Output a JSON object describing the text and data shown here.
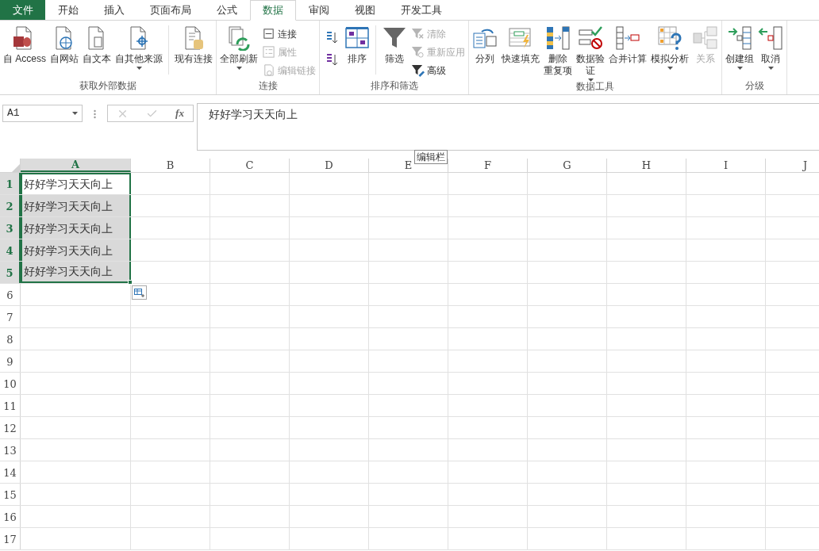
{
  "tabs": [
    {
      "label": "文件",
      "kind": "file",
      "selected": false
    },
    {
      "label": "开始",
      "kind": "tab",
      "selected": false
    },
    {
      "label": "插入",
      "kind": "tab",
      "selected": false
    },
    {
      "label": "页面布局",
      "kind": "tab",
      "selected": false
    },
    {
      "label": "公式",
      "kind": "tab",
      "selected": false
    },
    {
      "label": "数据",
      "kind": "tab",
      "selected": true
    },
    {
      "label": "审阅",
      "kind": "tab",
      "selected": false
    },
    {
      "label": "视图",
      "kind": "tab",
      "selected": false
    },
    {
      "label": "开发工具",
      "kind": "tab",
      "selected": false
    }
  ],
  "ribbon_groups": [
    {
      "label": "获取外部数据",
      "items": [
        {
          "kind": "large",
          "lines": [
            "自 Access"
          ],
          "disabled": false,
          "dropdown": false
        },
        {
          "kind": "large",
          "lines": [
            "自网站"
          ],
          "disabled": false,
          "dropdown": false
        },
        {
          "kind": "large",
          "lines": [
            "自文本"
          ],
          "disabled": false,
          "dropdown": false
        },
        {
          "kind": "large",
          "lines": [
            "自其他来源"
          ],
          "disabled": false,
          "dropdown": true
        },
        {
          "kind": "separator"
        },
        {
          "kind": "large",
          "lines": [
            "现有连接"
          ],
          "disabled": false,
          "dropdown": false
        }
      ]
    },
    {
      "label": "连接",
      "items": [
        {
          "kind": "large",
          "lines": [
            "全部刷新"
          ],
          "disabled": false,
          "dropdown": true
        },
        {
          "kind": "stack",
          "buttons": [
            {
              "label": "连接",
              "disabled": false
            },
            {
              "label": "属性",
              "disabled": true
            },
            {
              "label": "编辑链接",
              "disabled": true
            }
          ]
        }
      ]
    },
    {
      "label": "排序和筛选",
      "items": [
        {
          "kind": "icons"
        },
        {
          "kind": "large",
          "lines": [
            "排序"
          ],
          "disabled": false,
          "dropdown": false
        },
        {
          "kind": "separator"
        },
        {
          "kind": "large",
          "lines": [
            "筛选"
          ],
          "disabled": false,
          "dropdown": false
        },
        {
          "kind": "stack",
          "buttons": [
            {
              "label": "清除",
              "disabled": true
            },
            {
              "label": "重新应用",
              "disabled": true
            },
            {
              "label": "高级",
              "disabled": false
            }
          ]
        }
      ]
    },
    {
      "label": "数据工具",
      "items": [
        {
          "kind": "large",
          "lines": [
            "分列"
          ],
          "disabled": false,
          "dropdown": false
        },
        {
          "kind": "large",
          "lines": [
            "快速填充"
          ],
          "disabled": false,
          "dropdown": false
        },
        {
          "kind": "large",
          "lines": [
            "删除",
            "重复项"
          ],
          "disabled": false,
          "dropdown": false
        },
        {
          "kind": "large",
          "lines": [
            "数据验",
            "证"
          ],
          "disabled": false,
          "dropdown": true
        },
        {
          "kind": "large",
          "lines": [
            "合并计算"
          ],
          "disabled": false,
          "dropdown": false
        },
        {
          "kind": "large",
          "lines": [
            "模拟分析"
          ],
          "disabled": false,
          "dropdown": true
        },
        {
          "kind": "large",
          "lines": [
            "关系"
          ],
          "disabled": true,
          "dropdown": false
        }
      ]
    },
    {
      "label": "分级",
      "items": [
        {
          "kind": "large",
          "lines": [
            "创建组"
          ],
          "disabled": false,
          "dropdown": true
        },
        {
          "kind": "large",
          "lines": [
            "取消"
          ],
          "disabled": false,
          "dropdown": true
        }
      ]
    }
  ],
  "name_box": {
    "value": "A1"
  },
  "formula_bar": {
    "fx": "fx",
    "value": "好好学习天天向上"
  },
  "tooltip": "编辑栏",
  "sheet": {
    "columns": [
      {
        "label": "A",
        "selected": true
      },
      {
        "label": "B",
        "selected": false
      },
      {
        "label": "C",
        "selected": false
      },
      {
        "label": "D",
        "selected": false
      },
      {
        "label": "E",
        "selected": false
      },
      {
        "label": "F",
        "selected": false
      },
      {
        "label": "G",
        "selected": false
      },
      {
        "label": "H",
        "selected": false
      },
      {
        "label": "I",
        "selected": false
      },
      {
        "label": "J",
        "selected": false
      }
    ],
    "rows": [
      {
        "label": "1",
        "selected": true,
        "cells": [
          {
            "value": "好好学习天天向上",
            "selected": true,
            "active": true
          }
        ]
      },
      {
        "label": "2",
        "selected": true,
        "cells": [
          {
            "value": "好好学习天天向上",
            "selected": true,
            "active": false
          }
        ]
      },
      {
        "label": "3",
        "selected": true,
        "cells": [
          {
            "value": "好好学习天天向上",
            "selected": true,
            "active": false
          }
        ]
      },
      {
        "label": "4",
        "selected": true,
        "cells": [
          {
            "value": "好好学习天天向上",
            "selected": true,
            "active": false
          }
        ]
      },
      {
        "label": "5",
        "selected": true,
        "cells": [
          {
            "value": "好好学习天天向上",
            "selected": true,
            "active": false
          }
        ]
      },
      {
        "label": "6",
        "selected": false
      },
      {
        "label": "7",
        "selected": false
      },
      {
        "label": "8",
        "selected": false
      },
      {
        "label": "9",
        "selected": false
      },
      {
        "label": "10",
        "selected": false
      },
      {
        "label": "11",
        "selected": false
      },
      {
        "label": "12",
        "selected": false
      },
      {
        "label": "13",
        "selected": false
      },
      {
        "label": "14",
        "selected": false
      },
      {
        "label": "15",
        "selected": false
      },
      {
        "label": "16",
        "selected": false
      },
      {
        "label": "17",
        "selected": false
      }
    ]
  }
}
